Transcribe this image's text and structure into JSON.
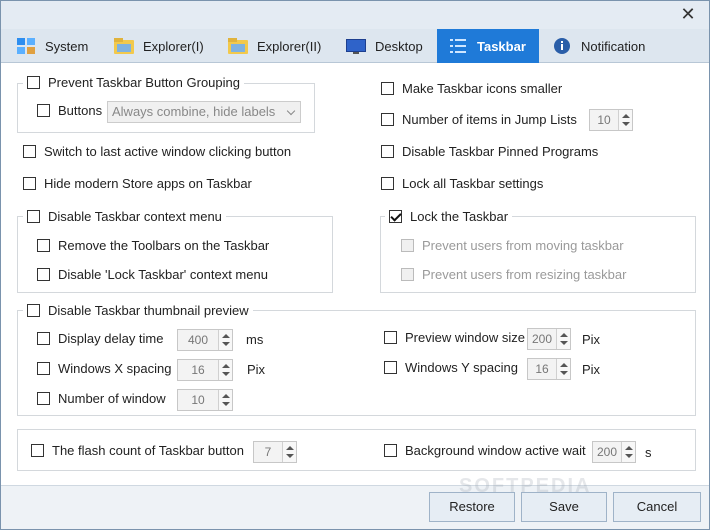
{
  "tabs": [
    {
      "label": "System",
      "icon": "system-icon"
    },
    {
      "label": "Explorer(I)",
      "icon": "folder-icon"
    },
    {
      "label": "Explorer(II)",
      "icon": "folder-icon"
    },
    {
      "label": "Desktop",
      "icon": "desktop-icon"
    },
    {
      "label": "Taskbar",
      "icon": "taskbar-icon",
      "active": true
    },
    {
      "label": "Notification",
      "icon": "info-icon"
    }
  ],
  "left": {
    "grouping": {
      "label": "Prevent Taskbar Button Grouping",
      "checked": false
    },
    "buttons": {
      "label": "Buttons",
      "checked": false,
      "select_value": "Always combine, hide labels"
    },
    "switch_last": {
      "label": "Switch to last active window clicking button",
      "checked": false
    },
    "hide_store": {
      "label": "Hide modern Store apps on Taskbar",
      "checked": false
    },
    "context_menu": {
      "label": "Disable Taskbar context menu",
      "checked": false
    },
    "remove_toolbars": {
      "label": "Remove the Toolbars on the Taskbar",
      "checked": false
    },
    "disable_lock_ctx": {
      "label": "Disable 'Lock Taskbar' context menu",
      "checked": false
    }
  },
  "right": {
    "icons_smaller": {
      "label": "Make Taskbar icons smaller",
      "checked": false
    },
    "jump_lists": {
      "label": "Number of items in Jump Lists",
      "checked": false,
      "value": "10"
    },
    "pinned": {
      "label": "Disable Taskbar Pinned Programs",
      "checked": false
    },
    "lock_all": {
      "label": "Lock all Taskbar settings",
      "checked": false
    },
    "lock_taskbar": {
      "label": "Lock the Taskbar",
      "checked": true
    },
    "prevent_moving": {
      "label": "Prevent users from moving taskbar",
      "checked": false
    },
    "prevent_resizing": {
      "label": "Prevent users from resizing taskbar",
      "checked": false
    }
  },
  "thumbnail": {
    "label": "Disable Taskbar thumbnail preview",
    "display_delay": {
      "label": "Display delay time",
      "value": "400",
      "unit": "ms"
    },
    "x_spacing": {
      "label": "Windows X spacing",
      "value": "16",
      "unit": "Pix"
    },
    "num_window": {
      "label": "Number of window",
      "value": "10"
    },
    "preview_size": {
      "label": "Preview window size",
      "value": "200",
      "unit": "Pix"
    },
    "y_spacing": {
      "label": "Windows Y spacing",
      "value": "16",
      "unit": "Pix"
    }
  },
  "flash": {
    "label": "The flash count of Taskbar button",
    "value": "7",
    "bg_label": "Background window active wait",
    "bg_value": "200",
    "bg_unit": "s"
  },
  "footer": {
    "restore": "Restore",
    "save": "Save",
    "cancel": "Cancel"
  },
  "watermark": "SOFTPEDIA",
  "colors": {
    "accent": "#1f7ad8"
  }
}
